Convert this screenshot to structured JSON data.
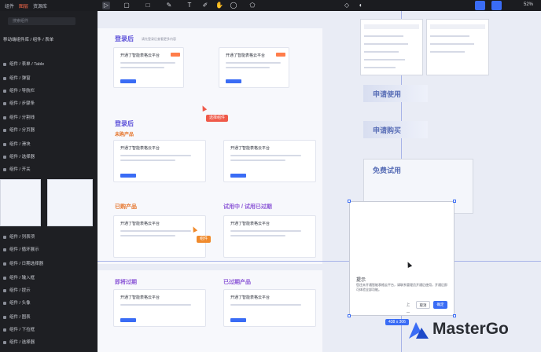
{
  "toolbar": {
    "tabs": [
      "组件",
      "图层",
      "资源库"
    ],
    "zoom_label": "52%"
  },
  "sidebar": {
    "search_placeholder": "搜索组件",
    "path": "移动端组件库 / 组件 / 表单",
    "items": [
      "组件 / 表单 / Table",
      "组件 / 弹窗",
      "组件 / 导航栏",
      "组件 / 步骤条",
      "组件 / 分割线",
      "组件 / 分页器",
      "组件 / 滑块",
      "组件 / 选择器",
      "组件 / 开关",
      "组件 / 列表项",
      "组件 / 循环展示",
      "组件 / 日期选择器",
      "组件 / 输入框",
      "组件 / 提示",
      "组件 / 头像",
      "组件 / 图表",
      "组件 / 下拉框",
      "组件 / 选择器"
    ]
  },
  "canvas": {
    "sections": [
      {
        "title": "登录后",
        "subtitle": "请先登录后查看更多内容"
      },
      {
        "title": "登录后",
        "subtitle": "未购产品"
      },
      {
        "title": "已购产品",
        "subtitle": "试用中 / 试用已过期"
      },
      {
        "title": "即将过期",
        "subtitle": "已过期产品"
      }
    ],
    "card_title": "开通了智能表格云平台",
    "chip_selected": "选择组件",
    "chip_orange": "组件",
    "banners": [
      "申请使用",
      "申请购买",
      "免费试用"
    ],
    "dialog": {
      "title": "提示",
      "text": "您还未开通智能表格云平台，请联系管理员开通后使用，开通后即可体验全部功能。",
      "cancel": "取消",
      "confirm": "确定",
      "prev": "上一"
    },
    "size_badge": "438 x 306"
  },
  "brand": {
    "name": "MasterGo",
    "accent": "#3a6cf5"
  }
}
